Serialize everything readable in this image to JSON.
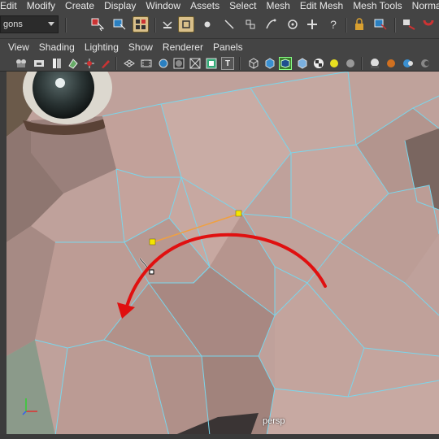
{
  "menubar": {
    "items": [
      "Edit",
      "Modify",
      "Create",
      "Display",
      "Window",
      "Assets",
      "Select",
      "Mesh",
      "Edit Mesh",
      "Mesh Tools",
      "Normals"
    ]
  },
  "shelf": {
    "mode_value": "gons",
    "icons": [
      "select-tool-icon",
      "lasso-icon",
      "paint-select-icon",
      "snap-icon",
      "magnet-icon",
      "soft-select-icon",
      "multi-cut-icon",
      "vertex-icon",
      "edge-icon",
      "bevel-icon",
      "target-weld-icon",
      "insert-loop-icon",
      "append-icon",
      "help-icon",
      "lock-icon",
      "symmetry-icon",
      "undo-icon",
      "uv-icon"
    ]
  },
  "panel_menu": {
    "items": [
      "View",
      "Shading",
      "Lighting",
      "Show",
      "Renderer",
      "Panels"
    ]
  },
  "panel_toolbar": {
    "icons": [
      "camera-icon",
      "camera-attr-icon",
      "bookmark-icon",
      "image-plane-icon",
      "twodpan-icon",
      "grease-pencil-icon",
      "grid-icon",
      "film-gate-icon",
      "resolution-gate-icon",
      "gate-mask-icon",
      "field-chart-icon",
      "safe-action-icon",
      "safe-title-icon",
      "wireframe-icon",
      "smooth-shade-icon",
      "wireframe-on-shaded-icon",
      "isolate-icon",
      "xray-icon",
      "texture-icon",
      "lights-icon",
      "shadows-icon",
      "ao-icon",
      "aa-icon",
      "dof-icon"
    ]
  },
  "viewport": {
    "camera_label": "persp"
  },
  "colors": {
    "wire": "#7ad6ec",
    "vertex": "#f5e500",
    "edge_highlight": "#f0a040",
    "arrow": "#e01010"
  }
}
